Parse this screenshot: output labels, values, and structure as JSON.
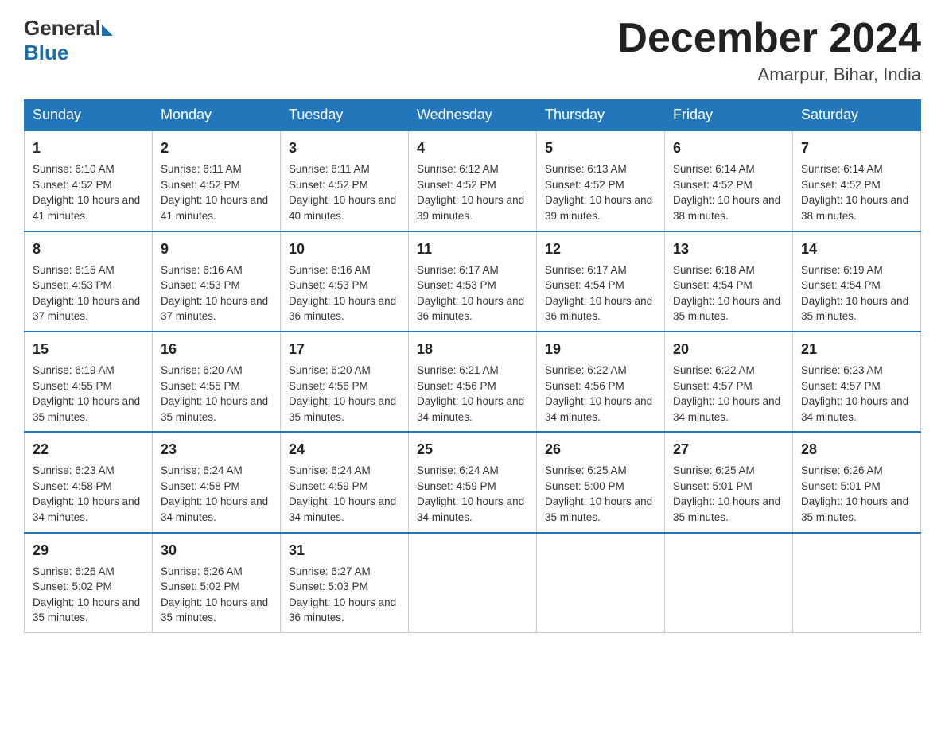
{
  "header": {
    "logo_general": "General",
    "logo_blue": "Blue",
    "month_title": "December 2024",
    "location": "Amarpur, Bihar, India"
  },
  "days_of_week": [
    "Sunday",
    "Monday",
    "Tuesday",
    "Wednesday",
    "Thursday",
    "Friday",
    "Saturday"
  ],
  "weeks": [
    [
      {
        "day": "1",
        "sunrise": "6:10 AM",
        "sunset": "4:52 PM",
        "daylight": "10 hours and 41 minutes."
      },
      {
        "day": "2",
        "sunrise": "6:11 AM",
        "sunset": "4:52 PM",
        "daylight": "10 hours and 41 minutes."
      },
      {
        "day": "3",
        "sunrise": "6:11 AM",
        "sunset": "4:52 PM",
        "daylight": "10 hours and 40 minutes."
      },
      {
        "day": "4",
        "sunrise": "6:12 AM",
        "sunset": "4:52 PM",
        "daylight": "10 hours and 39 minutes."
      },
      {
        "day": "5",
        "sunrise": "6:13 AM",
        "sunset": "4:52 PM",
        "daylight": "10 hours and 39 minutes."
      },
      {
        "day": "6",
        "sunrise": "6:14 AM",
        "sunset": "4:52 PM",
        "daylight": "10 hours and 38 minutes."
      },
      {
        "day": "7",
        "sunrise": "6:14 AM",
        "sunset": "4:52 PM",
        "daylight": "10 hours and 38 minutes."
      }
    ],
    [
      {
        "day": "8",
        "sunrise": "6:15 AM",
        "sunset": "4:53 PM",
        "daylight": "10 hours and 37 minutes."
      },
      {
        "day": "9",
        "sunrise": "6:16 AM",
        "sunset": "4:53 PM",
        "daylight": "10 hours and 37 minutes."
      },
      {
        "day": "10",
        "sunrise": "6:16 AM",
        "sunset": "4:53 PM",
        "daylight": "10 hours and 36 minutes."
      },
      {
        "day": "11",
        "sunrise": "6:17 AM",
        "sunset": "4:53 PM",
        "daylight": "10 hours and 36 minutes."
      },
      {
        "day": "12",
        "sunrise": "6:17 AM",
        "sunset": "4:54 PM",
        "daylight": "10 hours and 36 minutes."
      },
      {
        "day": "13",
        "sunrise": "6:18 AM",
        "sunset": "4:54 PM",
        "daylight": "10 hours and 35 minutes."
      },
      {
        "day": "14",
        "sunrise": "6:19 AM",
        "sunset": "4:54 PM",
        "daylight": "10 hours and 35 minutes."
      }
    ],
    [
      {
        "day": "15",
        "sunrise": "6:19 AM",
        "sunset": "4:55 PM",
        "daylight": "10 hours and 35 minutes."
      },
      {
        "day": "16",
        "sunrise": "6:20 AM",
        "sunset": "4:55 PM",
        "daylight": "10 hours and 35 minutes."
      },
      {
        "day": "17",
        "sunrise": "6:20 AM",
        "sunset": "4:56 PM",
        "daylight": "10 hours and 35 minutes."
      },
      {
        "day": "18",
        "sunrise": "6:21 AM",
        "sunset": "4:56 PM",
        "daylight": "10 hours and 34 minutes."
      },
      {
        "day": "19",
        "sunrise": "6:22 AM",
        "sunset": "4:56 PM",
        "daylight": "10 hours and 34 minutes."
      },
      {
        "day": "20",
        "sunrise": "6:22 AM",
        "sunset": "4:57 PM",
        "daylight": "10 hours and 34 minutes."
      },
      {
        "day": "21",
        "sunrise": "6:23 AM",
        "sunset": "4:57 PM",
        "daylight": "10 hours and 34 minutes."
      }
    ],
    [
      {
        "day": "22",
        "sunrise": "6:23 AM",
        "sunset": "4:58 PM",
        "daylight": "10 hours and 34 minutes."
      },
      {
        "day": "23",
        "sunrise": "6:24 AM",
        "sunset": "4:58 PM",
        "daylight": "10 hours and 34 minutes."
      },
      {
        "day": "24",
        "sunrise": "6:24 AM",
        "sunset": "4:59 PM",
        "daylight": "10 hours and 34 minutes."
      },
      {
        "day": "25",
        "sunrise": "6:24 AM",
        "sunset": "4:59 PM",
        "daylight": "10 hours and 34 minutes."
      },
      {
        "day": "26",
        "sunrise": "6:25 AM",
        "sunset": "5:00 PM",
        "daylight": "10 hours and 35 minutes."
      },
      {
        "day": "27",
        "sunrise": "6:25 AM",
        "sunset": "5:01 PM",
        "daylight": "10 hours and 35 minutes."
      },
      {
        "day": "28",
        "sunrise": "6:26 AM",
        "sunset": "5:01 PM",
        "daylight": "10 hours and 35 minutes."
      }
    ],
    [
      {
        "day": "29",
        "sunrise": "6:26 AM",
        "sunset": "5:02 PM",
        "daylight": "10 hours and 35 minutes."
      },
      {
        "day": "30",
        "sunrise": "6:26 AM",
        "sunset": "5:02 PM",
        "daylight": "10 hours and 35 minutes."
      },
      {
        "day": "31",
        "sunrise": "6:27 AM",
        "sunset": "5:03 PM",
        "daylight": "10 hours and 36 minutes."
      },
      null,
      null,
      null,
      null
    ]
  ],
  "labels": {
    "sunrise": "Sunrise:",
    "sunset": "Sunset:",
    "daylight": "Daylight:"
  }
}
